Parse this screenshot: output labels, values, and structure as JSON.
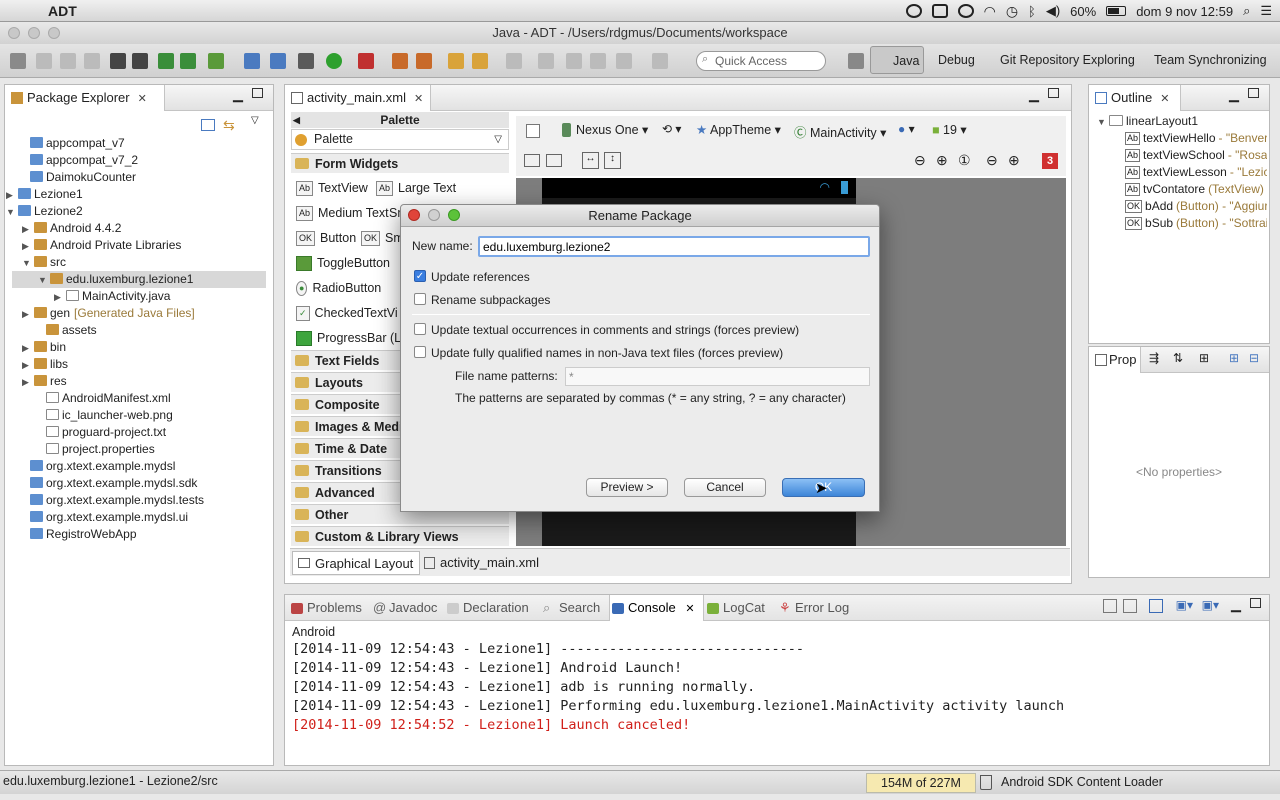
{
  "menubar": {
    "app_name": "ADT",
    "battery": "60%",
    "datetime": "dom 9 nov 12:59"
  },
  "window": {
    "title": "Java - ADT - /Users/rdgmus/Documents/workspace"
  },
  "toolbar": {
    "quick_access_placeholder": "Quick Access",
    "perspectives": [
      "Java",
      "Debug",
      "Git Repository Exploring",
      "Team Synchronizing"
    ]
  },
  "package_explorer": {
    "title": "Package Explorer",
    "items": [
      {
        "label": "appcompat_v7",
        "decor": ""
      },
      {
        "label": "appcompat_v7_2",
        "decor": ""
      },
      {
        "label": "DaimokuCounter",
        "decor": ""
      },
      {
        "label": "Lezione1",
        "decor": ""
      },
      {
        "label": "Lezione2",
        "decor": ""
      },
      {
        "label": "Android 4.4.2",
        "decor": ""
      },
      {
        "label": "Android Private Libraries",
        "decor": ""
      },
      {
        "label": "src",
        "decor": ""
      },
      {
        "label": "edu.luxemburg.lezione1",
        "decor": ""
      },
      {
        "label": "MainActivity.java",
        "decor": ""
      },
      {
        "label": "gen",
        "decor": "[Generated Java Files]"
      },
      {
        "label": "assets",
        "decor": ""
      },
      {
        "label": "bin",
        "decor": ""
      },
      {
        "label": "libs",
        "decor": ""
      },
      {
        "label": "res",
        "decor": ""
      },
      {
        "label": "AndroidManifest.xml",
        "decor": ""
      },
      {
        "label": "ic_launcher-web.png",
        "decor": ""
      },
      {
        "label": "proguard-project.txt",
        "decor": ""
      },
      {
        "label": "project.properties",
        "decor": ""
      },
      {
        "label": "org.xtext.example.mydsl",
        "decor": ""
      },
      {
        "label": "org.xtext.example.mydsl.sdk",
        "decor": ""
      },
      {
        "label": "org.xtext.example.mydsl.tests",
        "decor": ""
      },
      {
        "label": "org.xtext.example.mydsl.ui",
        "decor": ""
      },
      {
        "label": "RegistroWebApp",
        "decor": ""
      }
    ]
  },
  "editor": {
    "tab": "activity_main.xml",
    "palette_title": "Palette",
    "palette_dropdown": "Palette",
    "form_widgets": "Form Widgets",
    "widgets": [
      "TextView",
      "Large Text",
      "Medium Text",
      "Sm",
      "Button",
      "Sm",
      "ToggleButton",
      "RadioButton",
      "CheckedTextVi",
      "ProgressBar (La"
    ],
    "categories": [
      "Text Fields",
      "Layouts",
      "Composite",
      "Images & Media",
      "Time & Date",
      "Transitions",
      "Advanced",
      "Other",
      "Custom & Library Views"
    ],
    "device": "Nexus One",
    "theme": "AppTheme",
    "activity": "MainActivity",
    "api": "19",
    "error_count": "3",
    "bottom_tabs": [
      "Graphical Layout",
      "activity_main.xml"
    ]
  },
  "dialog": {
    "title": "Rename Package",
    "new_name_label": "New name:",
    "new_name_value": "edu.luxemburg.lezione2",
    "update_references": "Update references",
    "rename_subpackages": "Rename subpackages",
    "update_textual": "Update textual occurrences in comments and strings (forces preview)",
    "update_qualified": "Update fully qualified names in non-Java text files (forces preview)",
    "file_patterns_label": "File name patterns:",
    "file_patterns_value": "*",
    "patterns_hint": "The patterns are separated by commas (* = any string, ? = any character)",
    "preview_button": "Preview >",
    "cancel_button": "Cancel",
    "ok_button": "OK"
  },
  "outline": {
    "title": "Outline",
    "root": "linearLayout1",
    "items": [
      {
        "name": "textViewHello",
        "detail": "- \"Benver"
      },
      {
        "name": "textViewSchool",
        "detail": "- \"Rosa"
      },
      {
        "name": "textViewLesson",
        "detail": "- \"Lezic"
      },
      {
        "name": "tvContatore",
        "detail": "(TextView)"
      },
      {
        "name": "bAdd",
        "detail": "(Button) - \"Aggiur"
      },
      {
        "name": "bSub",
        "detail": "(Button) - \"Sottrai"
      }
    ]
  },
  "properties": {
    "title": "Prop",
    "empty": "<No properties>"
  },
  "bottom_panel": {
    "tabs": [
      "Problems",
      "Javadoc",
      "Declaration",
      "Search",
      "Console",
      "LogCat",
      "Error Log"
    ],
    "console_header": "Android",
    "lines": [
      "[2014-11-09 12:54:43 - Lezione1] ------------------------------",
      "[2014-11-09 12:54:43 - Lezione1] Android Launch!",
      "[2014-11-09 12:54:43 - Lezione1] adb is running normally.",
      "[2014-11-09 12:54:43 - Lezione1] Performing edu.luxemburg.lezione1.MainActivity activity launch",
      "[2014-11-09 12:54:52 - Lezione1] Launch canceled!"
    ],
    "error_color": "#d0201a"
  },
  "statusbar": {
    "selection": "edu.luxemburg.lezione1 - Lezione2/src",
    "memory": "154M of 227M",
    "task": "Android SDK Content Loader"
  }
}
